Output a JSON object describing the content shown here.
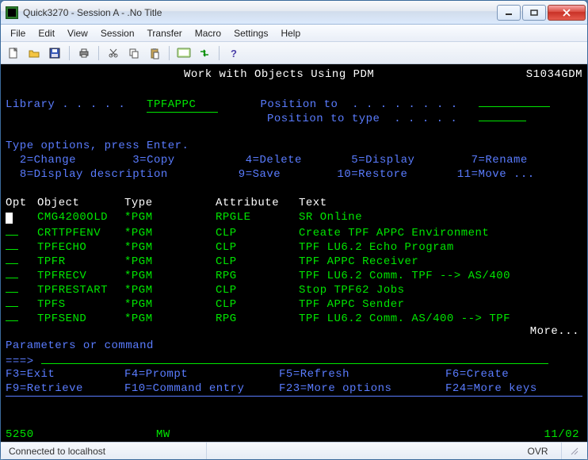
{
  "window": {
    "title": "Quick3270 - Session A - .No Title"
  },
  "menu": {
    "items": [
      "File",
      "Edit",
      "View",
      "Session",
      "Transfer",
      "Macro",
      "Settings",
      "Help"
    ]
  },
  "toolbar": {
    "icons": [
      "new",
      "open",
      "save",
      "print",
      "cut",
      "copy",
      "paste",
      "screen-toggle",
      "transfer",
      "help"
    ]
  },
  "screen": {
    "title": "Work with Objects Using PDM",
    "system_id": "S1034GDM",
    "library_label": "Library . . . . .",
    "library_value": "TPFAPPC   ",
    "position_to_label": "Position to  . . . . . . . .",
    "position_to_type_label": "Position to type  . . . . .",
    "position_to_value": "",
    "position_to_type_value": "",
    "options_header": "Type options, press Enter.",
    "options": [
      {
        "code": "2",
        "text": "Change"
      },
      {
        "code": "3",
        "text": "Copy"
      },
      {
        "code": "4",
        "text": "Delete"
      },
      {
        "code": "5",
        "text": "Display"
      },
      {
        "code": "7",
        "text": "Rename"
      },
      {
        "code": "8",
        "text": "Display description"
      },
      {
        "code": "9",
        "text": "Save"
      },
      {
        "code": "10",
        "text": "Restore"
      },
      {
        "code": "11",
        "text": "Move ..."
      }
    ],
    "columns": {
      "opt": "Opt",
      "object": "Object",
      "type": "Type",
      "attribute": "Attribute",
      "text": "Text"
    },
    "rows": [
      {
        "object": "CMG4200OLD",
        "type": "*PGM",
        "attribute": "RPGLE",
        "text": "SR Online"
      },
      {
        "object": "CRTTPFENV",
        "type": "*PGM",
        "attribute": "CLP",
        "text": "Create TPF APPC Environment"
      },
      {
        "object": "TPFECHO",
        "type": "*PGM",
        "attribute": "CLP",
        "text": "TPF LU6.2 Echo Program"
      },
      {
        "object": "TPFR",
        "type": "*PGM",
        "attribute": "CLP",
        "text": "TPF APPC Receiver"
      },
      {
        "object": "TPFRECV",
        "type": "*PGM",
        "attribute": "RPG",
        "text": "TPF LU6.2 Comm. TPF --> AS/400"
      },
      {
        "object": "TPFRESTART",
        "type": "*PGM",
        "attribute": "CLP",
        "text": "Stop TPF62 Jobs"
      },
      {
        "object": "TPFS",
        "type": "*PGM",
        "attribute": "CLP",
        "text": "TPF APPC Sender"
      },
      {
        "object": "TPFSEND",
        "type": "*PGM",
        "attribute": "RPG",
        "text": "TPF LU6.2 Comm. AS/400 --> TPF"
      }
    ],
    "more": "More...",
    "parameters_label": "Parameters or command",
    "command_prompt": "===>",
    "command_value": "",
    "fkeys_line1": [
      {
        "k": "F3",
        "t": "Exit"
      },
      {
        "k": "F4",
        "t": "Prompt"
      },
      {
        "k": "F5",
        "t": "Refresh"
      },
      {
        "k": "F6",
        "t": "Create"
      }
    ],
    "fkeys_line2": [
      {
        "k": "F9",
        "t": "Retrieve"
      },
      {
        "k": "F10",
        "t": "Command entry"
      },
      {
        "k": "F23",
        "t": "More options"
      },
      {
        "k": "F24",
        "t": "More keys"
      }
    ],
    "status5250": {
      "mode": "5250",
      "indicator": "MW",
      "cursor": "11/02"
    }
  },
  "statusbar": {
    "connection": "Connected to localhost",
    "ovr": "OVR"
  }
}
